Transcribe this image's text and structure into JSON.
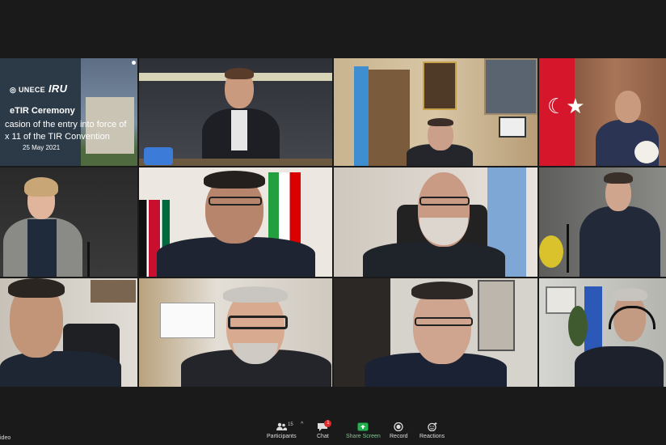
{
  "slide": {
    "org1": "UNECE",
    "org2": "IRU",
    "title": "eTIR Ceremony",
    "line1": "casion of the entry into force of",
    "line2": "x 11 of the TIR Convention",
    "date": "25 May 2021"
  },
  "toolbar": {
    "video_label": "ideo",
    "participants_label": "Participants",
    "participants_count": "15",
    "chat_label": "Chat",
    "chat_badge": "1",
    "share_label": "Share Screen",
    "record_label": "Record",
    "reactions_label": "Reactions"
  },
  "colors": {
    "background": "#1a1a1a",
    "share_green": "#22b14c",
    "badge_red": "#e02828"
  }
}
